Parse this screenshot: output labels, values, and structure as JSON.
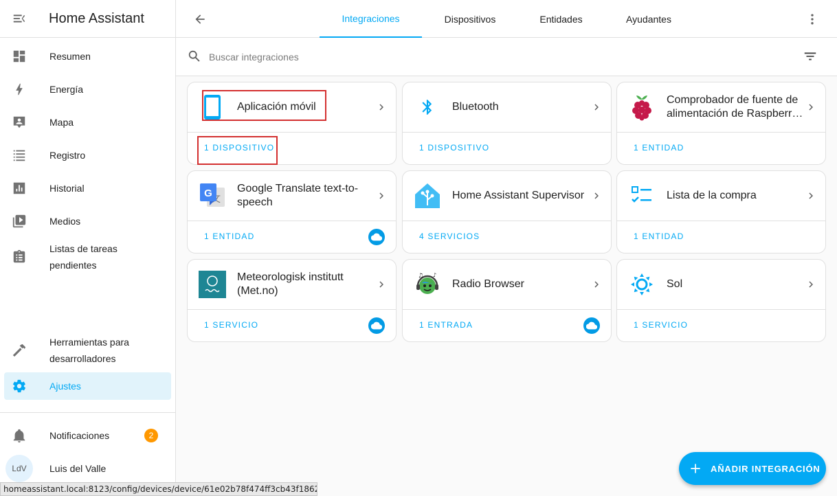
{
  "sidebar": {
    "title": "Home Assistant",
    "items": [
      {
        "label": "Resumen",
        "icon": "dashboard-icon"
      },
      {
        "label": "Energía",
        "icon": "lightning-bolt-icon"
      },
      {
        "label": "Mapa",
        "icon": "map-account-icon"
      },
      {
        "label": "Registro",
        "icon": "format-list-icon"
      },
      {
        "label": "Historial",
        "icon": "chart-box-icon"
      },
      {
        "label": "Medios",
        "icon": "play-box-multiple-icon"
      },
      {
        "label": "Listas de tareas pendientes",
        "icon": "clipboard-list-icon"
      },
      {
        "label": "Herramientas para desarrolladores",
        "icon": "hammer-icon"
      },
      {
        "label": "Ajustes",
        "icon": "cog-icon",
        "active": true
      }
    ],
    "notifications": {
      "label": "Notificaciones",
      "count": "2"
    },
    "user": {
      "initials": "LdV",
      "name": "Luis del Valle"
    }
  },
  "topbar": {
    "tabs": [
      {
        "label": "Integraciones",
        "active": true
      },
      {
        "label": "Dispositivos"
      },
      {
        "label": "Entidades"
      },
      {
        "label": "Ayudantes"
      }
    ]
  },
  "search": {
    "placeholder": "Buscar integraciones",
    "value": ""
  },
  "integrations": [
    {
      "name": "Aplicación móvil",
      "link": "1 DISPOSITIVO",
      "cloud": false,
      "logo": "mobile-app-icon"
    },
    {
      "name": "Bluetooth",
      "link": "1 DISPOSITIVO",
      "cloud": false,
      "logo": "bluetooth-icon"
    },
    {
      "name": "Comprobador de fuente de alimentación de Raspberr…",
      "link": "1 ENTIDAD",
      "cloud": false,
      "logo": "raspberry-pi-icon"
    },
    {
      "name": "Google Translate text-to-speech",
      "link": "1 ENTIDAD",
      "cloud": true,
      "logo": "google-translate-icon"
    },
    {
      "name": "Home Assistant Supervisor",
      "link": "4 SERVICIOS",
      "cloud": false,
      "logo": "supervisor-icon"
    },
    {
      "name": "Lista de la compra",
      "link": "1 ENTIDAD",
      "cloud": false,
      "logo": "shopping-list-icon"
    },
    {
      "name": "Meteorologisk institutt (Met.no)",
      "link": "1 SERVICIO",
      "cloud": true,
      "logo": "met-no-icon"
    },
    {
      "name": "Radio Browser",
      "link": "1 ENTRADA",
      "cloud": true,
      "logo": "radio-browser-icon"
    },
    {
      "name": "Sol",
      "link": "1 SERVICIO",
      "cloud": false,
      "logo": "sun-icon"
    }
  ],
  "fab": {
    "label": "AÑADIR INTEGRACIÓN"
  },
  "statusbar": {
    "url": "homeassistant.local:8123/config/devices/device/61e02b78f474ff3cb43f1862e6827366"
  },
  "colors": {
    "accent": "#03a9f4",
    "badge": "#ff9800",
    "highlight": "#d32f2f"
  }
}
